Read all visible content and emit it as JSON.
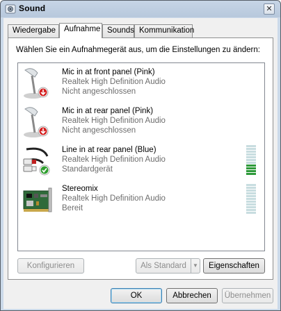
{
  "window": {
    "title": "Sound",
    "close_glyph": "✕"
  },
  "tabs": [
    {
      "label": "Wiedergabe"
    },
    {
      "label": "Aufnahme",
      "active": true
    },
    {
      "label": "Sounds"
    },
    {
      "label": "Kommunikation"
    }
  ],
  "instruction": "Wählen Sie ein Aufnahmegerät aus, um die Einstellungen zu ändern:",
  "devices": [
    {
      "name": "Mic in at front panel (Pink)",
      "driver": "Realtek High Definition Audio",
      "status": "Nicht angeschlossen",
      "icon": "microphone-icon",
      "level_fraction": null
    },
    {
      "name": "Mic in at rear panel (Pink)",
      "driver": "Realtek High Definition Audio",
      "status": "Nicht angeschlossen",
      "icon": "microphone-icon",
      "level_fraction": null
    },
    {
      "name": "Line in at rear panel (Blue)",
      "driver": "Realtek High Definition Audio",
      "status": "Standardgerät",
      "icon": "rca-cable-icon",
      "level_fraction": 0.4
    },
    {
      "name": "Stereomix",
      "driver": "Realtek High Definition Audio",
      "status": "Bereit",
      "icon": "sound-card-icon",
      "level_fraction": 0
    }
  ],
  "panel_buttons": {
    "configure": "Konfigurieren",
    "set_default": "Als Standard",
    "properties": "Eigenschaften"
  },
  "dialog_buttons": {
    "ok": "OK",
    "cancel": "Abbrechen",
    "apply": "Übernehmen"
  },
  "colors": {
    "meter_on": "#2e9a3a",
    "meter_off": "#c8dde0",
    "disconnected_badge": "#d42020",
    "default_badge": "#2f9e2f"
  }
}
